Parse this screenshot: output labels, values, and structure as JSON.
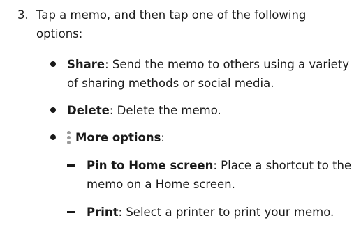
{
  "step": {
    "number": "3.",
    "text": "Tap a memo, and then tap one of the following options:"
  },
  "options": [
    {
      "term": "Share",
      "description": ": Send the memo to others using a variety of sharing methods or social media."
    },
    {
      "term": "Delete",
      "description": ": Delete the memo."
    },
    {
      "term": "More options",
      "description": ":",
      "icon": "more-options-kebab-icon"
    }
  ],
  "sub_options": [
    {
      "term": "Pin to Home screen",
      "description": ": Place a shortcut to the memo on a Home screen."
    },
    {
      "term": "Print",
      "description": ": Select a printer to print your memo."
    }
  ],
  "colors": {
    "text": "#1a1a1a",
    "icon": "#9a9a9a"
  }
}
